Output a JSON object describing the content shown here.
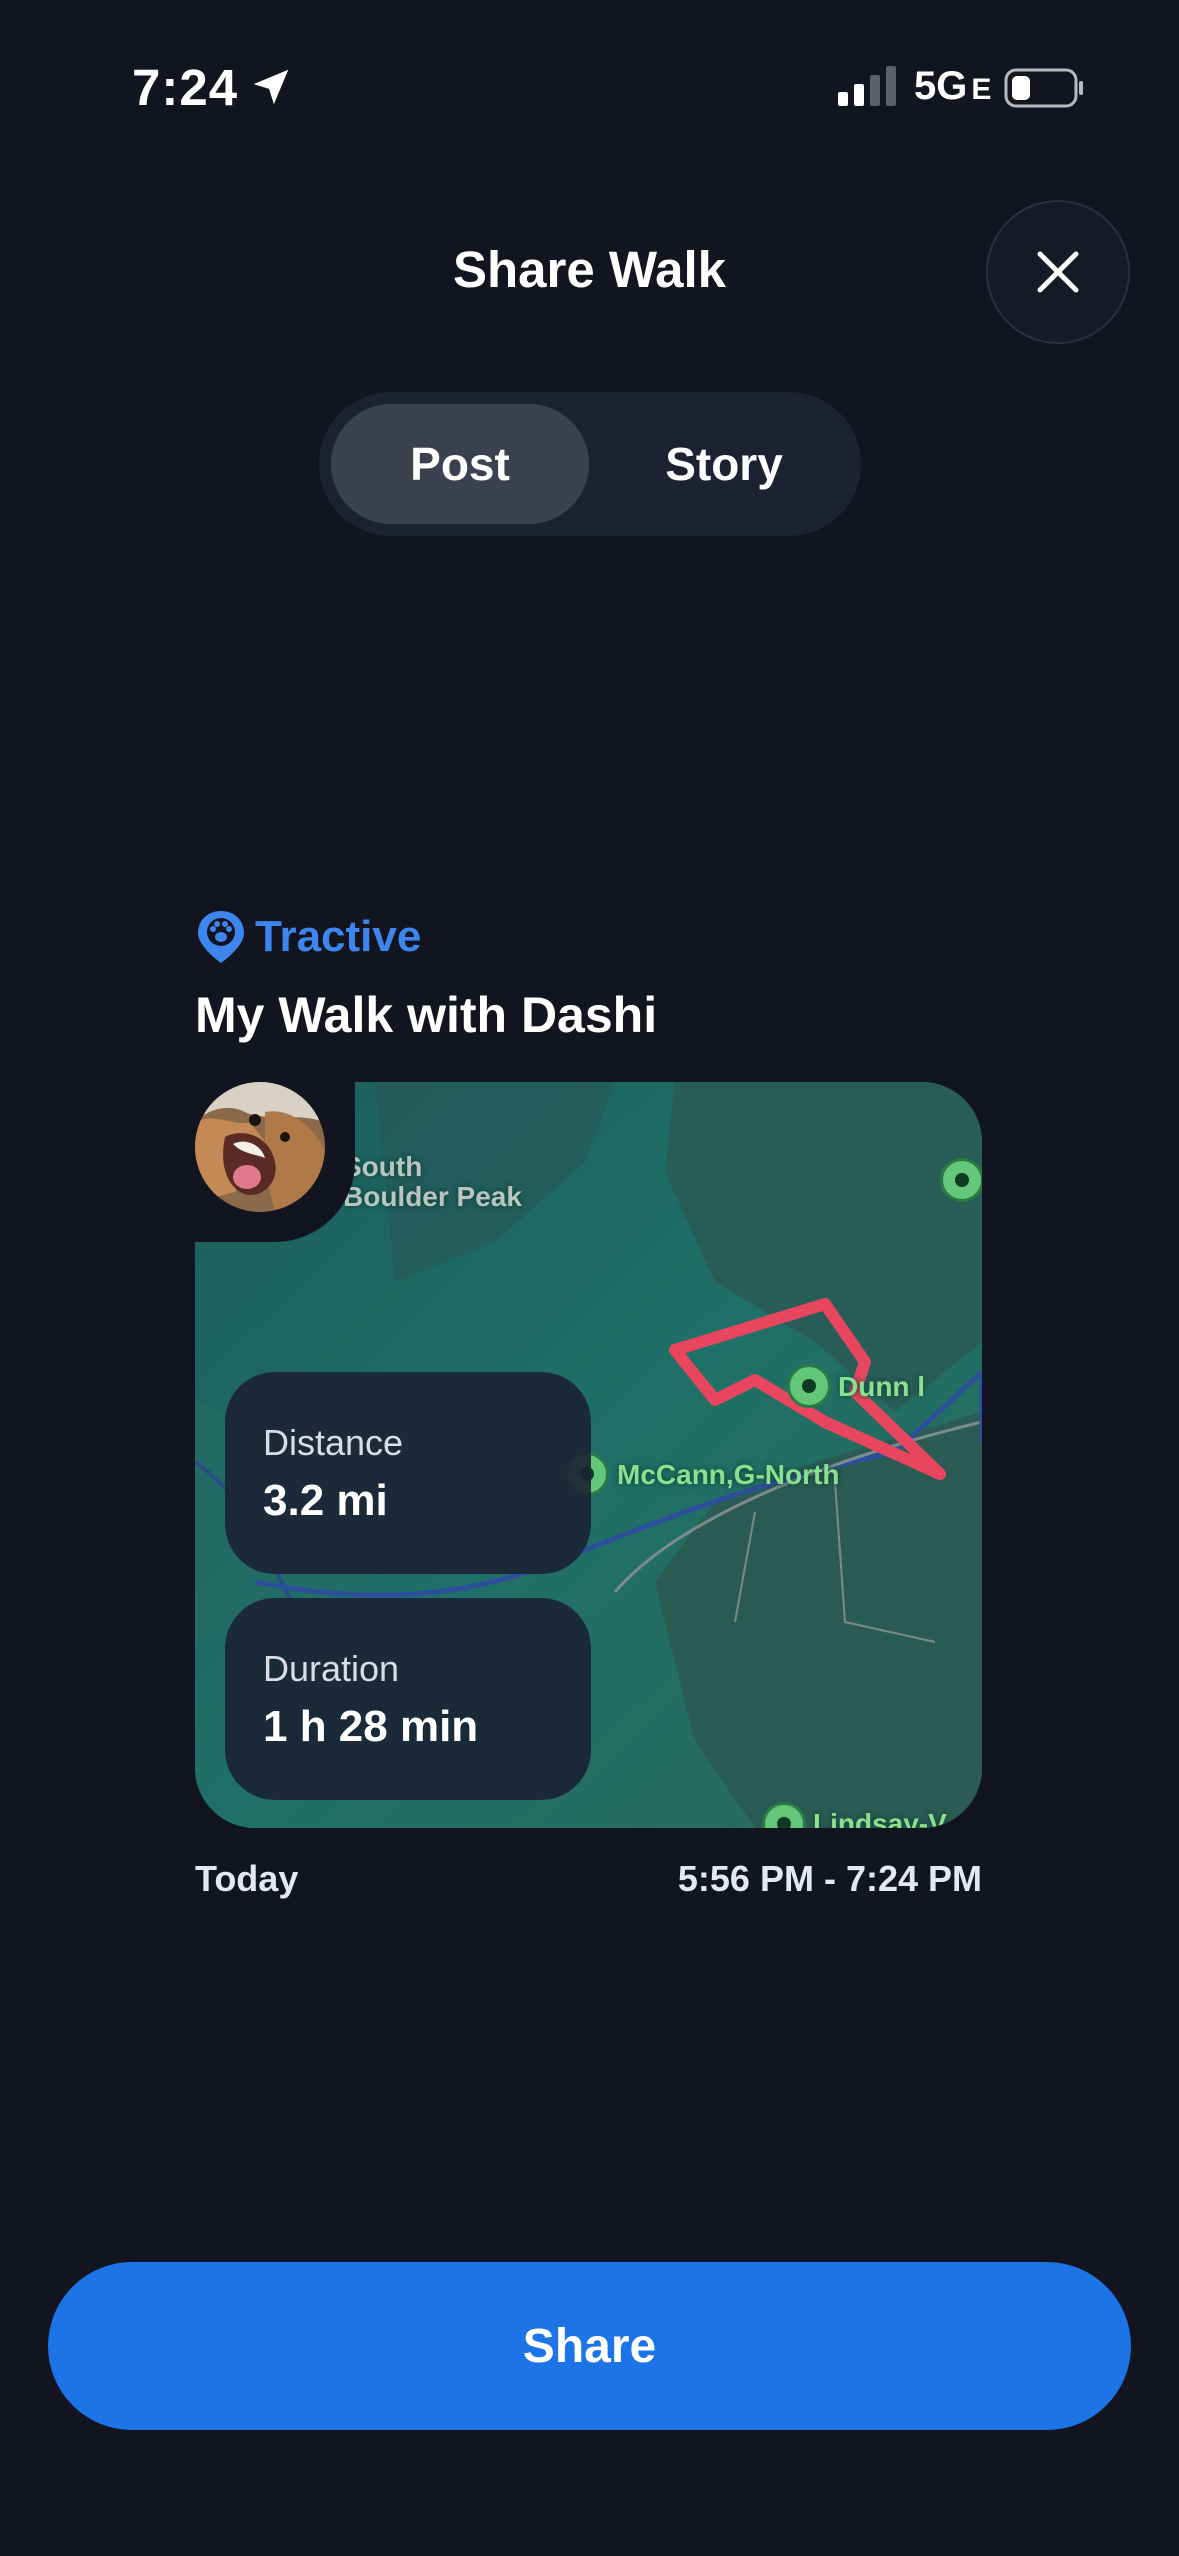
{
  "status_bar": {
    "time": "7:24",
    "network": "5G",
    "network_suffix": "E"
  },
  "header": {
    "title": "Share Walk"
  },
  "tabs": [
    {
      "label": "Post",
      "selected": true
    },
    {
      "label": "Story",
      "selected": false
    }
  ],
  "card": {
    "brand": "Tractive",
    "title": "My Walk with Dashi",
    "map_labels": {
      "peak_line1": "South",
      "peak_line2": "Boulder Peak",
      "place1": "Dunn l",
      "place2": "McCann,G-North",
      "place3": "Lindsay-V"
    },
    "stats": [
      {
        "label": "Distance",
        "value": "3.2 mi"
      },
      {
        "label": "Duration",
        "value": "1 h 28 min"
      }
    ],
    "date": "Today",
    "time_range": "5:56 PM - 7:24 PM"
  },
  "actions": {
    "share_label": "Share"
  },
  "colors": {
    "accent": "#1c74e6",
    "brand": "#3d86f0",
    "route": "#e8465e",
    "map": "#1f6e68",
    "background": "#12151f"
  }
}
